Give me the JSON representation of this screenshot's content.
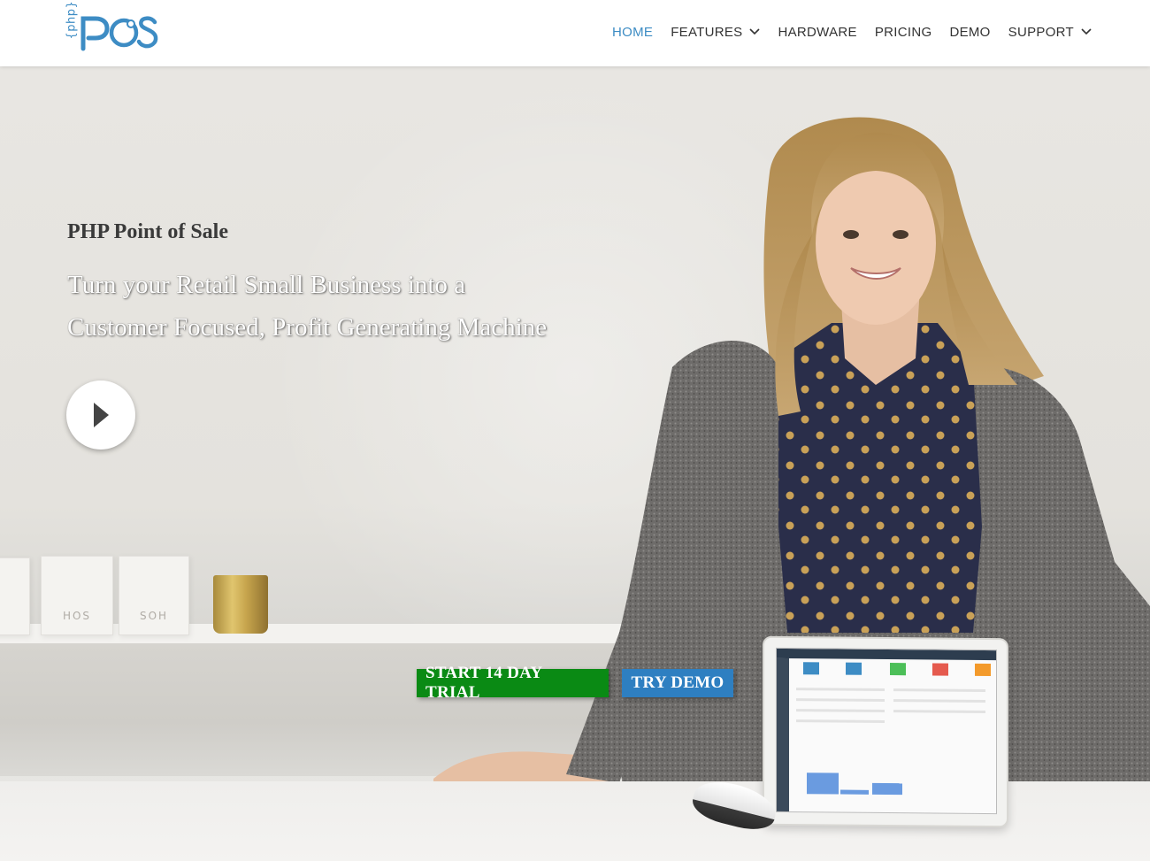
{
  "header": {
    "logo": {
      "prefix": "{php}",
      "text": "POS"
    },
    "nav": [
      {
        "label": "HOME",
        "active": true,
        "dropdown": false
      },
      {
        "label": "FEATURES",
        "active": false,
        "dropdown": true
      },
      {
        "label": "HARDWARE",
        "active": false,
        "dropdown": false
      },
      {
        "label": "PRICING",
        "active": false,
        "dropdown": false
      },
      {
        "label": "DEMO",
        "active": false,
        "dropdown": false
      },
      {
        "label": "SUPPORT",
        "active": false,
        "dropdown": true
      }
    ]
  },
  "hero": {
    "eyebrow": "PHP Point of Sale",
    "headline_line1": "Turn your Retail Small Business into a",
    "headline_line2": "Customer Focused, Profit Generating Machine",
    "play_icon": "play-icon",
    "cta_trial": "START 14 DAY TRIAL",
    "cta_demo": "TRY DEMO"
  },
  "colors": {
    "brand_blue": "#3d8cc4",
    "trial_green": "#0a8a14",
    "demo_blue": "#2e7fc1"
  }
}
